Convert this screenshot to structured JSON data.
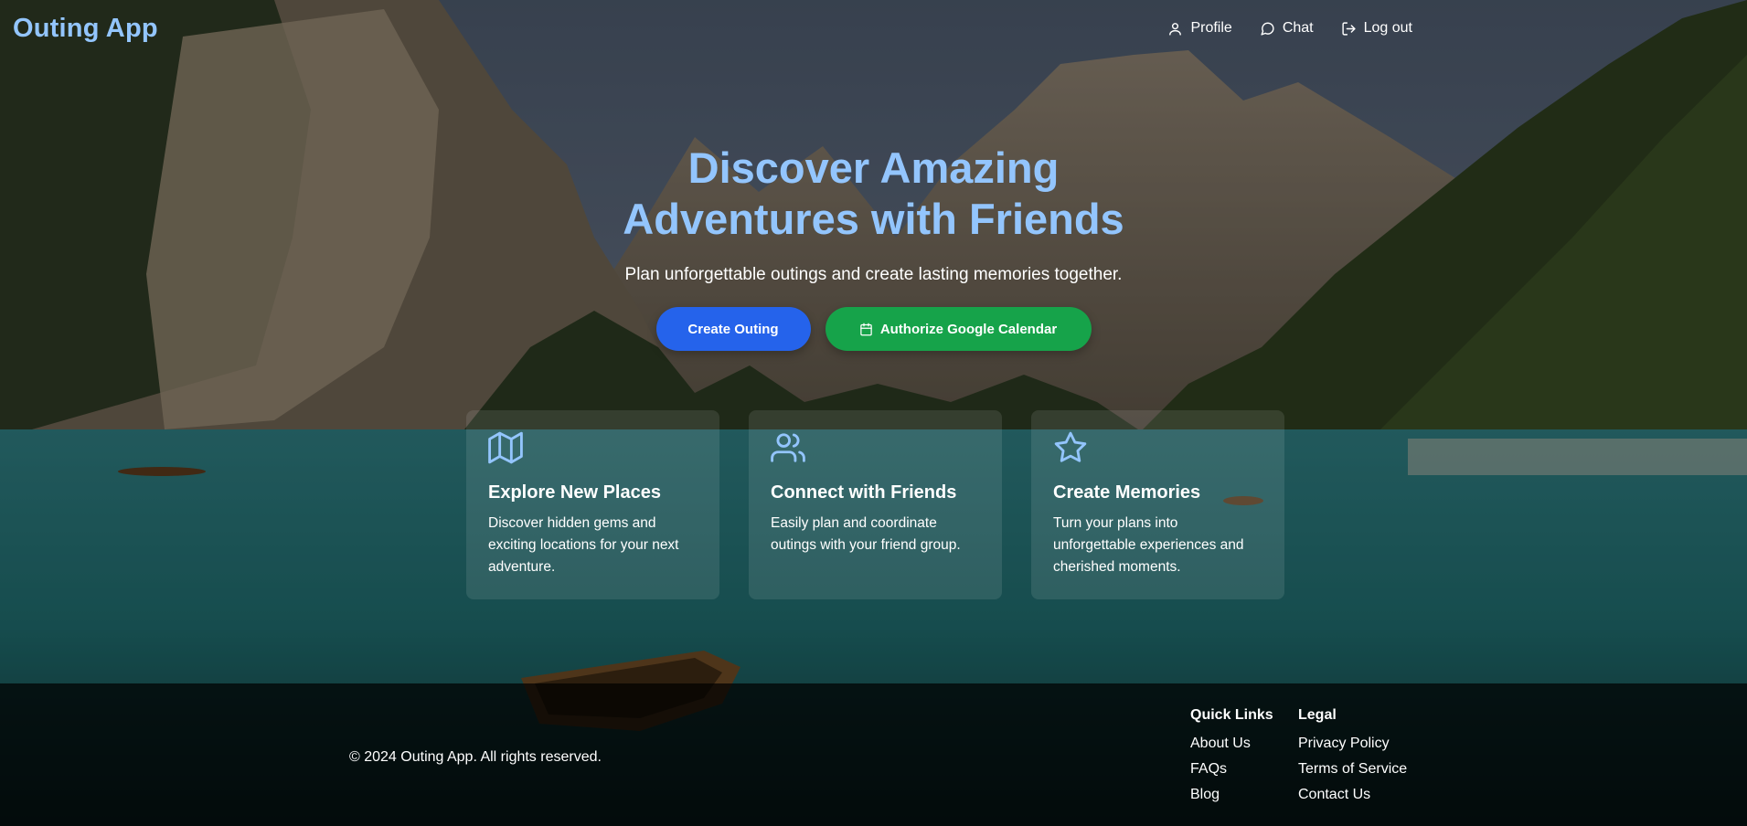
{
  "header": {
    "logo": "Outing App",
    "nav": [
      {
        "label": "Profile",
        "icon": "user-icon"
      },
      {
        "label": "Chat",
        "icon": "message-circle-icon"
      },
      {
        "label": "Log out",
        "icon": "log-out-icon"
      }
    ]
  },
  "hero": {
    "title": "Discover Amazing Adventures with Friends",
    "subtitle": "Plan unforgettable outings and create lasting memories together.",
    "create_button": "Create Outing",
    "calendar_button": "Authorize Google Calendar",
    "calendar_icon": "calendar-icon"
  },
  "features": [
    {
      "icon": "map-icon",
      "title": "Explore New Places",
      "text": "Discover hidden gems and exciting locations for your next adventure."
    },
    {
      "icon": "users-icon",
      "title": "Connect with Friends",
      "text": "Easily plan and coordinate outings with your friend group."
    },
    {
      "icon": "star-icon",
      "title": "Create Memories",
      "text": "Turn your plans into unforgettable experiences and cherished moments."
    }
  ],
  "footer": {
    "copyright": "© 2024 Outing App. All rights reserved.",
    "quick_links": {
      "heading": "Quick Links",
      "links": [
        "About Us",
        "FAQs",
        "Blog"
      ]
    },
    "legal": {
      "heading": "Legal",
      "links": [
        "Privacy Policy",
        "Terms of Service",
        "Contact Us"
      ]
    }
  },
  "colors": {
    "accent": "#93c5fd",
    "primary_button": "#2563eb",
    "success_button": "#16a34a"
  }
}
